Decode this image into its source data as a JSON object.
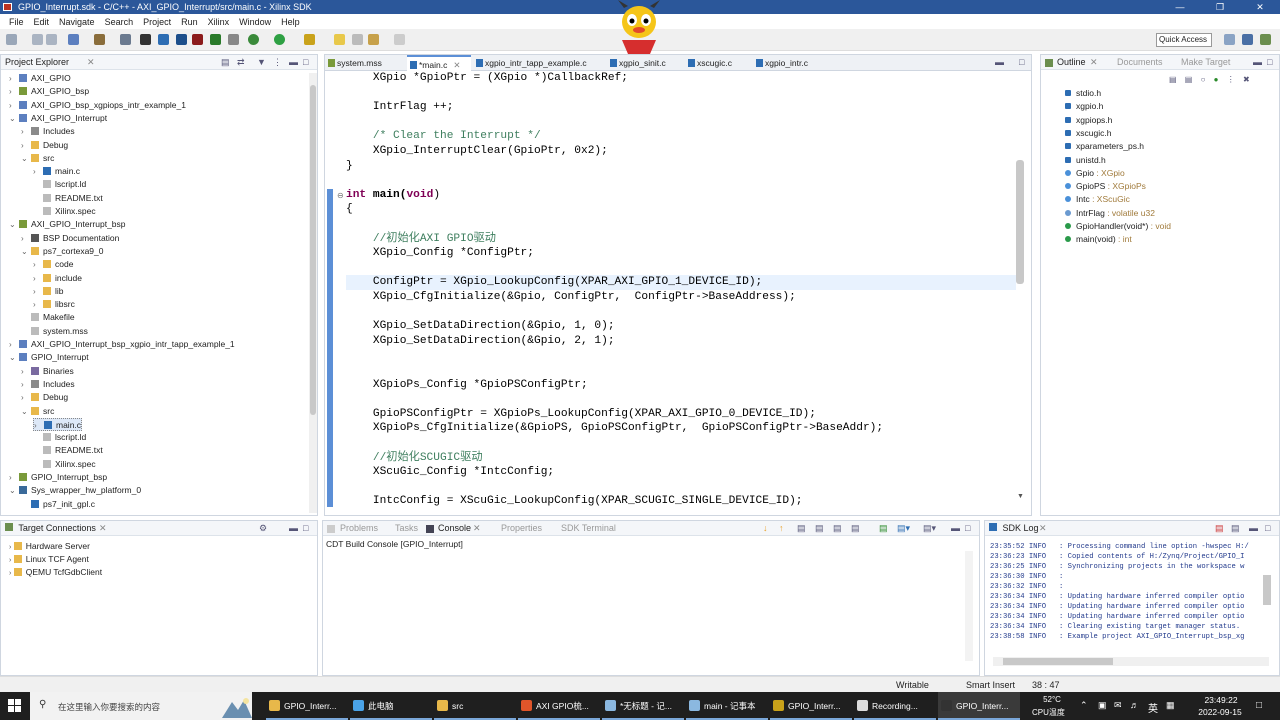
{
  "window": {
    "title": "GPIO_Interrupt.sdk - C/C++ - AXI_GPIO_Interrupt/src/main.c - Xilinx SDK"
  },
  "menu": [
    "File",
    "Edit",
    "Navigate",
    "Search",
    "Project",
    "Run",
    "Xilinx",
    "Window",
    "Help"
  ],
  "toolbar": {
    "quick_access": "Quick Access"
  },
  "project_explorer": {
    "title": "Project Explorer",
    "items": [
      {
        "label": "AXI_GPIO",
        "indent": 0,
        "expanded": false,
        "icon": "project-icon"
      },
      {
        "label": "AXI_GPIO_bsp",
        "indent": 0,
        "expanded": false,
        "icon": "bsp-icon"
      },
      {
        "label": "AXI_GPIO_bsp_xgpiops_intr_example_1",
        "indent": 0,
        "expanded": false,
        "icon": "project-icon"
      },
      {
        "label": "AXI_GPIO_Interrupt",
        "indent": 0,
        "expanded": true,
        "icon": "project-icon"
      },
      {
        "label": "Includes",
        "indent": 1,
        "expanded": false,
        "icon": "includes-icon"
      },
      {
        "label": "Debug",
        "indent": 1,
        "expanded": false,
        "icon": "folder-icon"
      },
      {
        "label": "src",
        "indent": 1,
        "expanded": true,
        "icon": "folder-icon"
      },
      {
        "label": "main.c",
        "indent": 2,
        "expanded": false,
        "icon": "c-file-icon"
      },
      {
        "label": "lscript.ld",
        "indent": 2,
        "expanded": null,
        "icon": "file-icon"
      },
      {
        "label": "README.txt",
        "indent": 2,
        "expanded": null,
        "icon": "file-icon"
      },
      {
        "label": "Xilinx.spec",
        "indent": 2,
        "expanded": null,
        "icon": "file-icon"
      },
      {
        "label": "AXI_GPIO_Interrupt_bsp",
        "indent": 0,
        "expanded": true,
        "icon": "bsp-icon"
      },
      {
        "label": "BSP Documentation",
        "indent": 1,
        "expanded": false,
        "icon": "doc-icon"
      },
      {
        "label": "ps7_cortexa9_0",
        "indent": 1,
        "expanded": true,
        "icon": "folder-icon"
      },
      {
        "label": "code",
        "indent": 2,
        "expanded": false,
        "icon": "folder-icon"
      },
      {
        "label": "include",
        "indent": 2,
        "expanded": false,
        "icon": "folder-icon"
      },
      {
        "label": "lib",
        "indent": 2,
        "expanded": false,
        "icon": "folder-icon"
      },
      {
        "label": "libsrc",
        "indent": 2,
        "expanded": false,
        "icon": "folder-icon"
      },
      {
        "label": "Makefile",
        "indent": 1,
        "expanded": null,
        "icon": "file-icon"
      },
      {
        "label": "system.mss",
        "indent": 1,
        "expanded": null,
        "icon": "file-icon"
      },
      {
        "label": "AXI_GPIO_Interrupt_bsp_xgpio_intr_tapp_example_1",
        "indent": 0,
        "expanded": false,
        "icon": "project-icon"
      },
      {
        "label": "GPIO_Interrupt",
        "indent": 0,
        "expanded": true,
        "icon": "project-icon"
      },
      {
        "label": "Binaries",
        "indent": 1,
        "expanded": false,
        "icon": "binaries-icon"
      },
      {
        "label": "Includes",
        "indent": 1,
        "expanded": false,
        "icon": "includes-icon"
      },
      {
        "label": "Debug",
        "indent": 1,
        "expanded": false,
        "icon": "folder-icon"
      },
      {
        "label": "src",
        "indent": 1,
        "expanded": true,
        "icon": "folder-icon"
      },
      {
        "label": "main.c",
        "indent": 2,
        "expanded": false,
        "icon": "c-file-icon",
        "selected": true
      },
      {
        "label": "lscript.ld",
        "indent": 2,
        "expanded": null,
        "icon": "file-icon"
      },
      {
        "label": "README.txt",
        "indent": 2,
        "expanded": null,
        "icon": "file-icon"
      },
      {
        "label": "Xilinx.spec",
        "indent": 2,
        "expanded": null,
        "icon": "file-icon"
      },
      {
        "label": "GPIO_Interrupt_bsp",
        "indent": 0,
        "expanded": false,
        "icon": "bsp-icon"
      },
      {
        "label": "Sys_wrapper_hw_platform_0",
        "indent": 0,
        "expanded": true,
        "icon": "hw-icon"
      },
      {
        "label": "ps7_init_gpl.c",
        "indent": 1,
        "expanded": null,
        "icon": "c-file-icon"
      }
    ]
  },
  "target_connections": {
    "title": "Target Connections",
    "items": [
      "Hardware Server",
      "Linux TCF Agent",
      "QEMU TcfGdbClient"
    ]
  },
  "editor": {
    "tabs": [
      {
        "label": "system.mss",
        "active": false
      },
      {
        "label": "*main.c",
        "active": true
      },
      {
        "label": "xgpio_intr_tapp_example.c",
        "active": false
      },
      {
        "label": "xgpio_sinit.c",
        "active": false
      },
      {
        "label": "xscugic.c",
        "active": false
      },
      {
        "label": "xgpio_intr.c",
        "active": false
      }
    ],
    "lines": [
      {
        "text": "    XGpio *GpioPtr = (XGpio *)CallbackRef;",
        "kind": "code"
      },
      {
        "text": "",
        "kind": "code"
      },
      {
        "text": "    IntrFlag ++;",
        "kind": "code"
      },
      {
        "text": "",
        "kind": "code"
      },
      {
        "text": "    /* Clear the Interrupt */",
        "kind": "comment"
      },
      {
        "text": "    XGpio_InterruptClear(GpioPtr, 0x2);",
        "kind": "code"
      },
      {
        "text": "}",
        "kind": "code"
      },
      {
        "text": "",
        "kind": "code"
      },
      {
        "text": "int main(void)",
        "kind": "func"
      },
      {
        "text": "{",
        "kind": "code"
      },
      {
        "text": "",
        "kind": "code"
      },
      {
        "text": "    //初始化AXI GPIO驱动",
        "kind": "comment"
      },
      {
        "text": "    XGpio_Config *ConfigPtr;",
        "kind": "code"
      },
      {
        "text": "",
        "kind": "code"
      },
      {
        "text": "    ConfigPtr = XGpio_LookupConfig(XPAR_AXI_GPIO_1_DEVICE_ID);",
        "kind": "code",
        "highlight": true
      },
      {
        "text": "    XGpio_CfgInitialize(&Gpio, ConfigPtr,  ConfigPtr->BaseAddress);",
        "kind": "code"
      },
      {
        "text": "",
        "kind": "code"
      },
      {
        "text": "    XGpio_SetDataDirection(&Gpio, 1, 0);",
        "kind": "code"
      },
      {
        "text": "    XGpio_SetDataDirection(&Gpio, 2, 1);",
        "kind": "code"
      },
      {
        "text": "",
        "kind": "code"
      },
      {
        "text": "",
        "kind": "code"
      },
      {
        "text": "    XGpioPs_Config *GpioPSConfigPtr;",
        "kind": "code"
      },
      {
        "text": "",
        "kind": "code"
      },
      {
        "text": "    GpioPSConfigPtr = XGpioPs_LookupConfig(XPAR_AXI_GPIO_0_DEVICE_ID);",
        "kind": "code"
      },
      {
        "text": "    XGpioPs_CfgInitialize(&GpioPS, GpioPSConfigPtr,  GpioPSConfigPtr->BaseAddr);",
        "kind": "code"
      },
      {
        "text": "",
        "kind": "code"
      },
      {
        "text": "    //初始化SCUGIC驱动",
        "kind": "comment"
      },
      {
        "text": "    XScuGic_Config *IntcConfig;",
        "kind": "code"
      },
      {
        "text": "",
        "kind": "code"
      },
      {
        "text": "    IntcConfig = XScuGic_LookupConfig(XPAR_SCUGIC_SINGLE_DEVICE_ID);",
        "kind": "code"
      }
    ]
  },
  "outline": {
    "tabs": [
      "Outline",
      "Documents",
      "Make Target"
    ],
    "items": [
      {
        "name": "stdio.h",
        "type": "",
        "kind": "include"
      },
      {
        "name": "xgpio.h",
        "type": "",
        "kind": "include"
      },
      {
        "name": "xgpiops.h",
        "type": "",
        "kind": "include"
      },
      {
        "name": "xscugic.h",
        "type": "",
        "kind": "include"
      },
      {
        "name": "xparameters_ps.h",
        "type": "",
        "kind": "include"
      },
      {
        "name": "unistd.h",
        "type": "",
        "kind": "include"
      },
      {
        "name": "Gpio",
        "type": " : XGpio",
        "kind": "var"
      },
      {
        "name": "GpioPS",
        "type": " : XGpioPs",
        "kind": "var"
      },
      {
        "name": "Intc",
        "type": " : XScuGic",
        "kind": "var"
      },
      {
        "name": "IntrFlag",
        "type": " : volatile u32",
        "kind": "static"
      },
      {
        "name": "GpioHandler(void*)",
        "type": " : void",
        "kind": "func"
      },
      {
        "name": "main(void)",
        "type": " : int",
        "kind": "func"
      }
    ]
  },
  "console": {
    "tabs": [
      "Problems",
      "Tasks",
      "Console",
      "Properties",
      "SDK Terminal"
    ],
    "active": "Console",
    "header": "CDT Build Console [GPIO_Interrupt]"
  },
  "sdk_log": {
    "title": "SDK Log",
    "lines": [
      "23:35:52 INFO   : Processing command line option -hwspec H:/",
      "23:36:23 INFO   : Copied contents of H:/Zynq/Project/GPIO_I",
      "23:36:25 INFO   : Synchronizing projects in the workspace w",
      "23:36:30 INFO   :",
      "23:36:32 INFO   :",
      "23:36:34 INFO   : Updating hardware inferred compiler optio",
      "23:36:34 INFO   : Updating hardware inferred compiler optio",
      "23:36:34 INFO   : Updating hardware inferred compiler optio",
      "23:36:34 INFO   : Clearing existing target manager status.",
      "23:38:58 INFO   : Example project AXI_GPIO_Interrupt_bsp_xg"
    ]
  },
  "statusbar": {
    "mode": "Writable",
    "insert": "Smart Insert",
    "position": "38 : 47"
  },
  "taskbar": {
    "search_placeholder": "在这里输入你要搜索的内容",
    "tasks": [
      {
        "label": "GPIO_Interr...",
        "icon": "folder-icon",
        "color": "#e8b84a"
      },
      {
        "label": "此电脑",
        "icon": "pc-icon",
        "color": "#4aa3e8"
      },
      {
        "label": "src",
        "icon": "folder-icon",
        "color": "#e8b84a"
      },
      {
        "label": "AXI GPIO梳...",
        "icon": "chrome-icon",
        "color": "#e0552a"
      },
      {
        "label": "*无标题 - 记...",
        "icon": "notepad-icon",
        "color": "#8bb8e0"
      },
      {
        "label": "main - 记事本",
        "icon": "notepad-icon",
        "color": "#8bb8e0"
      },
      {
        "label": "GPIO_Interr...",
        "icon": "vivado-icon",
        "color": "#c9a21a"
      },
      {
        "label": "Recording...",
        "icon": "record-icon",
        "color": "#dddddd"
      },
      {
        "label": "GPIO_Interr...",
        "icon": "sdk-icon",
        "color": "#333333"
      }
    ],
    "weather_temp": "52°C",
    "weather_label": "CPU温度",
    "ime": "英",
    "time": "23:49:22",
    "date": "2022-09-15"
  }
}
